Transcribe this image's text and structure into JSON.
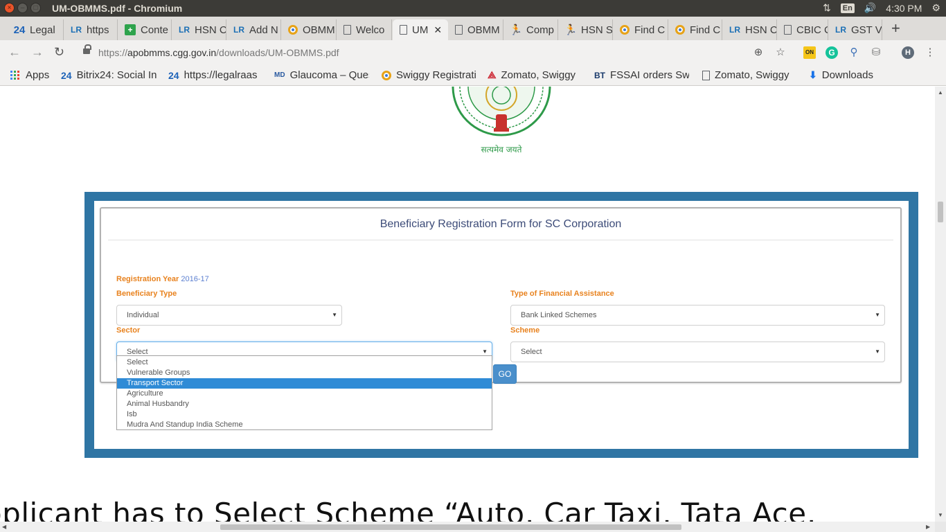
{
  "window": {
    "title": "UM-OBMMS.pdf - Chromium",
    "tray": {
      "keyboard": "En",
      "time": "4:30 PM"
    }
  },
  "tabs": [
    {
      "label": "Legal",
      "icon": "24"
    },
    {
      "label": "https",
      "icon": "LR"
    },
    {
      "label": "Conte",
      "icon": "plus"
    },
    {
      "label": "HSN C",
      "icon": "LR"
    },
    {
      "label": "Add N",
      "icon": "LR"
    },
    {
      "label": "OBMM",
      "icon": "chrome"
    },
    {
      "label": "Welco",
      "icon": "doc"
    },
    {
      "label": "UM",
      "icon": "doc",
      "active": true
    },
    {
      "label": "OBMM",
      "icon": "doc"
    },
    {
      "label": "Comp",
      "icon": "run"
    },
    {
      "label": "HSN S",
      "icon": "run"
    },
    {
      "label": "Find C",
      "icon": "chrome"
    },
    {
      "label": "Find C",
      "icon": "chrome"
    },
    {
      "label": "HSN C",
      "icon": "LR"
    },
    {
      "label": "CBIC C",
      "icon": "doc"
    },
    {
      "label": "GST V",
      "icon": "LR"
    }
  ],
  "tab_icon_text": {
    "t24": "24",
    "tlr": "LR",
    "tplus": "+"
  },
  "omnibox": {
    "url_scheme": "https://",
    "url_host": "apobmms.cgg.gov.in",
    "url_path": "/downloads/UM-OBMMS.pdf",
    "extension_on": "ON",
    "extension_g": "G",
    "profile_initial": "H"
  },
  "bookmarks": [
    {
      "label": "Apps",
      "icon": "apps-grid"
    },
    {
      "label": "Bitrix24: Social In",
      "icon": "24"
    },
    {
      "label": "https://legalraas",
      "icon": "24"
    },
    {
      "label": "Glaucoma – Quest",
      "icon": "WebMD"
    },
    {
      "label": "Swiggy Registrati",
      "icon": "chrome"
    },
    {
      "label": "Zomato, Swiggy",
      "icon": "zomato"
    },
    {
      "label": "FSSAI orders Swi",
      "icon": "BT"
    },
    {
      "label": "Zomato, Swiggy",
      "icon": "doc"
    },
    {
      "label": "Downloads",
      "icon": "download"
    }
  ],
  "bookmark_icon_text": {
    "b24": "24",
    "webmd": "MD",
    "bt": "BT"
  },
  "emblem": {
    "caption": "सत्यमेव जयते"
  },
  "form": {
    "title": "Beneficiary Registration Form for SC Corporation",
    "registration_year_label": "Registration Year",
    "registration_year_value": "2016-17",
    "beneficiary_type_label": "Beneficiary Type",
    "beneficiary_type_value": "Individual",
    "financial_assistance_label": "Type of Financial Assistance",
    "financial_assistance_value": "Bank Linked Schemes",
    "sector_label": "Sector",
    "sector_value": "Select",
    "scheme_label": "Scheme",
    "scheme_value": "Select",
    "go_label": "GO",
    "sector_options": [
      "Select",
      "Vulnerable Groups",
      "Transport Sector",
      "Agriculture",
      "Animal Husbandry",
      "Isb",
      "Mudra And Standup India Scheme"
    ]
  },
  "document_text": "pplicant has to Select Scheme “Auto, Car Taxi, Tata Ace,"
}
